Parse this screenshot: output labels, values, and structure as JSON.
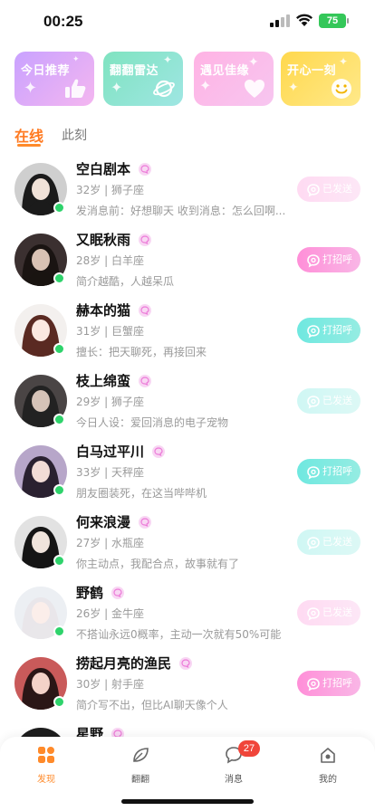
{
  "status_bar": {
    "time": "00:25",
    "battery": "75"
  },
  "feature_cards": [
    {
      "title": "今日推荐",
      "icon": "thumbs-up-icon",
      "gradient": [
        "#c9a2ff",
        "#f4b6f0"
      ]
    },
    {
      "title": "翻翻雷达",
      "icon": "planet-icon",
      "gradient": [
        "#7fe3c0",
        "#9fe6e3"
      ]
    },
    {
      "title": "遇见佳缘",
      "icon": "heart-icon",
      "gradient": [
        "#ffb3e4",
        "#f7c6f0"
      ]
    },
    {
      "title": "开心一刻",
      "icon": "smile-icon",
      "gradient": [
        "#ffd84d",
        "#ffe98a"
      ]
    }
  ],
  "tabs": {
    "online": "在线",
    "now": "此刻"
  },
  "users": [
    {
      "name": "空白剧本",
      "meta": "32岁 | 狮子座",
      "bio": "发消息前：好想聊天 收到消息：怎么回啊...",
      "button": "已发送",
      "button_style": "pink",
      "sent": true,
      "avatar_bg": "#cfcfcf",
      "avatar_hair": "#1b1b1b",
      "avatar_skin": "#f1e2d8"
    },
    {
      "name": "又眠秋雨",
      "meta": "28岁 | 白羊座",
      "bio": "简介越酷，人越呆瓜",
      "button": "打招呼",
      "button_style": "pink",
      "sent": false,
      "avatar_bg": "#3b3030",
      "avatar_hair": "#1a1412",
      "avatar_skin": "#d9c2b4"
    },
    {
      "name": "赫本的猫",
      "meta": "31岁 | 巨蟹座",
      "bio": "擅长：把天聊死，再接回来",
      "button": "打招呼",
      "button_style": "teal",
      "sent": false,
      "avatar_bg": "#f3f0ee",
      "avatar_hair": "#5a2a22",
      "avatar_skin": "#fbe9e1"
    },
    {
      "name": "枝上绵蛮",
      "meta": "29岁 | 狮子座",
      "bio": "今日人设：爱回消息的电子宠物",
      "button": "已发送",
      "button_style": "teal",
      "sent": true,
      "avatar_bg": "#4a4545",
      "avatar_hair": "#222",
      "avatar_skin": "#d5c3b8"
    },
    {
      "name": "白马过平川",
      "meta": "33岁 | 天秤座",
      "bio": "朋友圈装死，在这当哔哔机",
      "button": "打招呼",
      "button_style": "teal",
      "sent": false,
      "avatar_bg": "#b7a6c9",
      "avatar_hair": "#2a2130",
      "avatar_skin": "#f2dcd6"
    },
    {
      "name": "何来浪漫",
      "meta": "27岁 | 水瓶座",
      "bio": "你主动点，我配合点，故事就有了",
      "button": "已发送",
      "button_style": "teal",
      "sent": true,
      "avatar_bg": "#e2e2e2",
      "avatar_hair": "#151515",
      "avatar_skin": "#f0e4dc"
    },
    {
      "name": "野鹤",
      "meta": "26岁 | 金牛座",
      "bio": "不搭讪永远0概率，主动一次就有50%可能",
      "button": "已发送",
      "button_style": "pink",
      "sent": true,
      "avatar_bg": "#eceff3",
      "avatar_hair": "#e9e6ea",
      "avatar_skin": "#fbeeea"
    },
    {
      "name": "捞起月亮的渔民",
      "meta": "30岁 | 射手座",
      "bio": "简介写不出，但比AI聊天像个人",
      "button": "打招呼",
      "button_style": "pink",
      "sent": false,
      "avatar_bg": "#c95a5a",
      "avatar_hair": "#2b1616",
      "avatar_skin": "#f4d2c8"
    },
    {
      "name": "星野",
      "meta": "",
      "bio": "",
      "button": "",
      "button_style": "teal",
      "sent": true,
      "avatar_bg": "#1e1e1e",
      "avatar_hair": "#0d0d0d",
      "avatar_skin": "#d8c7bd"
    }
  ],
  "tabbar": {
    "discover": "发现",
    "flip": "翻翻",
    "messages": "消息",
    "messages_badge": "27",
    "me": "我的"
  },
  "colors": {
    "accent": "#ff8a2a",
    "online": "#2ed36b",
    "badge": "#f0453a"
  }
}
